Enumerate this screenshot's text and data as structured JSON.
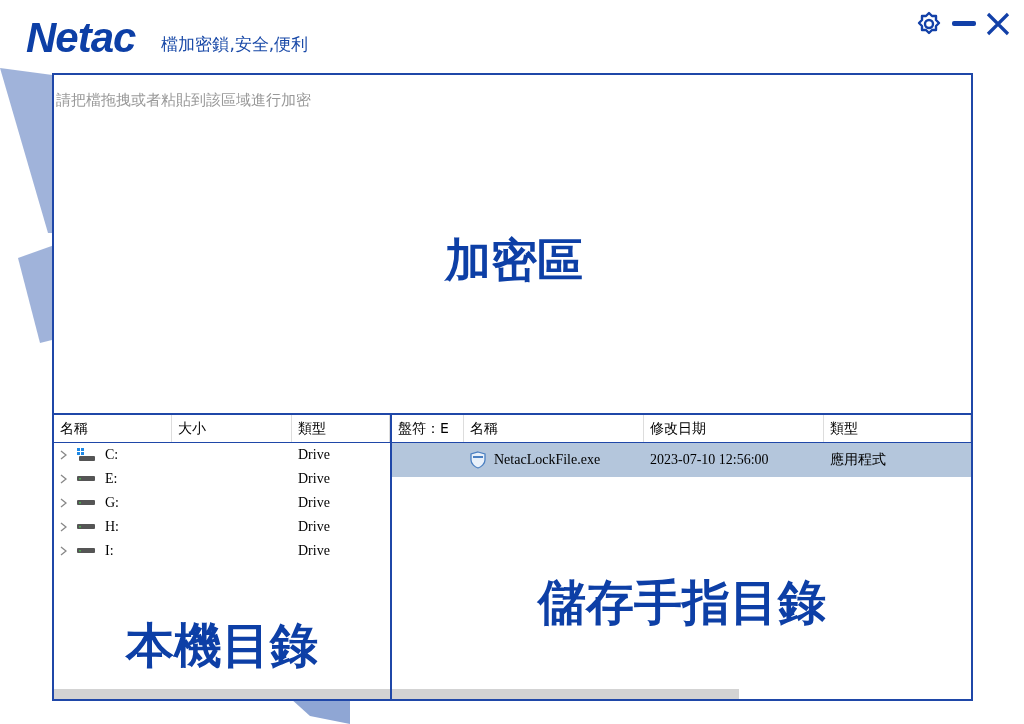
{
  "header": {
    "logo": "Netac",
    "tagline": "檔加密鎖,安全,便利"
  },
  "encrypt_area": {
    "hint": "請把檔拖拽或者粘貼到該區域進行加密",
    "title": "加密區"
  },
  "local_panel": {
    "columns": [
      "名稱",
      "大小",
      "類型"
    ],
    "rows": [
      {
        "name": "C:",
        "size": "",
        "type": "Drive",
        "kind": "system",
        "selected": false
      },
      {
        "name": "E:",
        "size": "",
        "type": "Drive",
        "kind": "drive",
        "selected": false
      },
      {
        "name": "G:",
        "size": "",
        "type": "Drive",
        "kind": "drive",
        "selected": false
      },
      {
        "name": "H:",
        "size": "",
        "type": "Drive",
        "kind": "drive",
        "selected": false
      },
      {
        "name": "I:",
        "size": "",
        "type": "Drive",
        "kind": "drive",
        "selected": false
      }
    ],
    "title": "本機目錄"
  },
  "usb_panel": {
    "columns": [
      "盤符：E",
      "名稱",
      "修改日期",
      "類型"
    ],
    "rows": [
      {
        "name": "NetacLockFile.exe",
        "modified": "2023-07-10 12:56:00",
        "type": "應用程式",
        "selected": true
      }
    ],
    "title": "儲存手指目錄"
  }
}
